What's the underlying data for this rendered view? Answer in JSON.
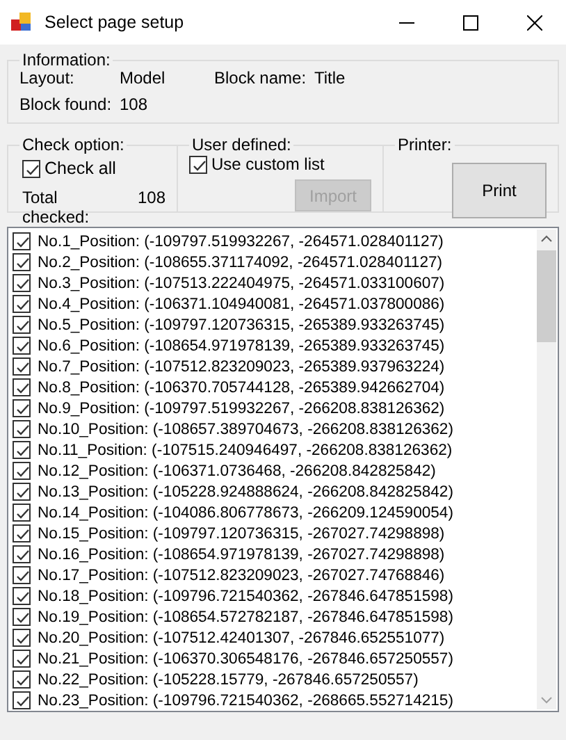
{
  "window": {
    "title": "Select page setup"
  },
  "information": {
    "legend": "Information:",
    "layout_label": "Layout:",
    "layout_value": "Model",
    "block_name_label": "Block name:",
    "block_name_value": "Title",
    "block_found_label": "Block found:",
    "block_found_value": "108"
  },
  "check_option": {
    "legend": "Check option:",
    "check_all": {
      "label": "Check all",
      "checked": true
    },
    "total_label": "Total checked:",
    "total_value": "108"
  },
  "user_defined": {
    "legend": "User defined:",
    "use_custom_list": {
      "label": "Use custom list",
      "checked": true
    },
    "import_button": {
      "label": "Import",
      "disabled": true
    }
  },
  "printer": {
    "legend": "Printer:",
    "print_button": {
      "label": "Print",
      "disabled": false
    }
  },
  "list": {
    "items": [
      {
        "label": "No.1_Position: (-109797.519932267, -264571.028401127)",
        "checked": true
      },
      {
        "label": "No.2_Position: (-108655.371174092, -264571.028401127)",
        "checked": true
      },
      {
        "label": "No.3_Position: (-107513.222404975, -264571.033100607)",
        "checked": true
      },
      {
        "label": "No.4_Position: (-106371.104940081, -264571.037800086)",
        "checked": true
      },
      {
        "label": "No.5_Position: (-109797.120736315, -265389.933263745)",
        "checked": true
      },
      {
        "label": "No.6_Position: (-108654.971978139, -265389.933263745)",
        "checked": true
      },
      {
        "label": "No.7_Position: (-107512.823209023, -265389.937963224)",
        "checked": true
      },
      {
        "label": "No.8_Position: (-106370.705744128, -265389.942662704)",
        "checked": true
      },
      {
        "label": "No.9_Position: (-109797.519932267, -266208.838126362)",
        "checked": true
      },
      {
        "label": "No.10_Position: (-108657.389704673, -266208.838126362)",
        "checked": true
      },
      {
        "label": "No.11_Position: (-107515.240946497, -266208.838126362)",
        "checked": true
      },
      {
        "label": "No.12_Position: (-106371.0736468, -266208.842825842)",
        "checked": true
      },
      {
        "label": "No.13_Position: (-105228.924888624, -266208.842825842)",
        "checked": true
      },
      {
        "label": "No.14_Position: (-104086.806778673, -266209.124590054)",
        "checked": true
      },
      {
        "label": "No.15_Position: (-109797.120736315, -267027.74298898)",
        "checked": true
      },
      {
        "label": "No.16_Position: (-108654.971978139, -267027.74298898)",
        "checked": true
      },
      {
        "label": "No.17_Position: (-107512.823209023, -267027.74768846)",
        "checked": true
      },
      {
        "label": "No.18_Position: (-109796.721540362, -267846.647851598)",
        "checked": true
      },
      {
        "label": "No.19_Position: (-108654.572782187, -267846.647851598)",
        "checked": true
      },
      {
        "label": "No.20_Position: (-107512.42401307, -267846.652551077)",
        "checked": true
      },
      {
        "label": "No.21_Position: (-106370.306548176, -267846.657250557)",
        "checked": true
      },
      {
        "label": "No.22_Position: (-105228.15779, -267846.657250557)",
        "checked": true
      },
      {
        "label": "No.23_Position: (-109796.721540362, -268665.552714215)",
        "checked": true
      }
    ]
  }
}
